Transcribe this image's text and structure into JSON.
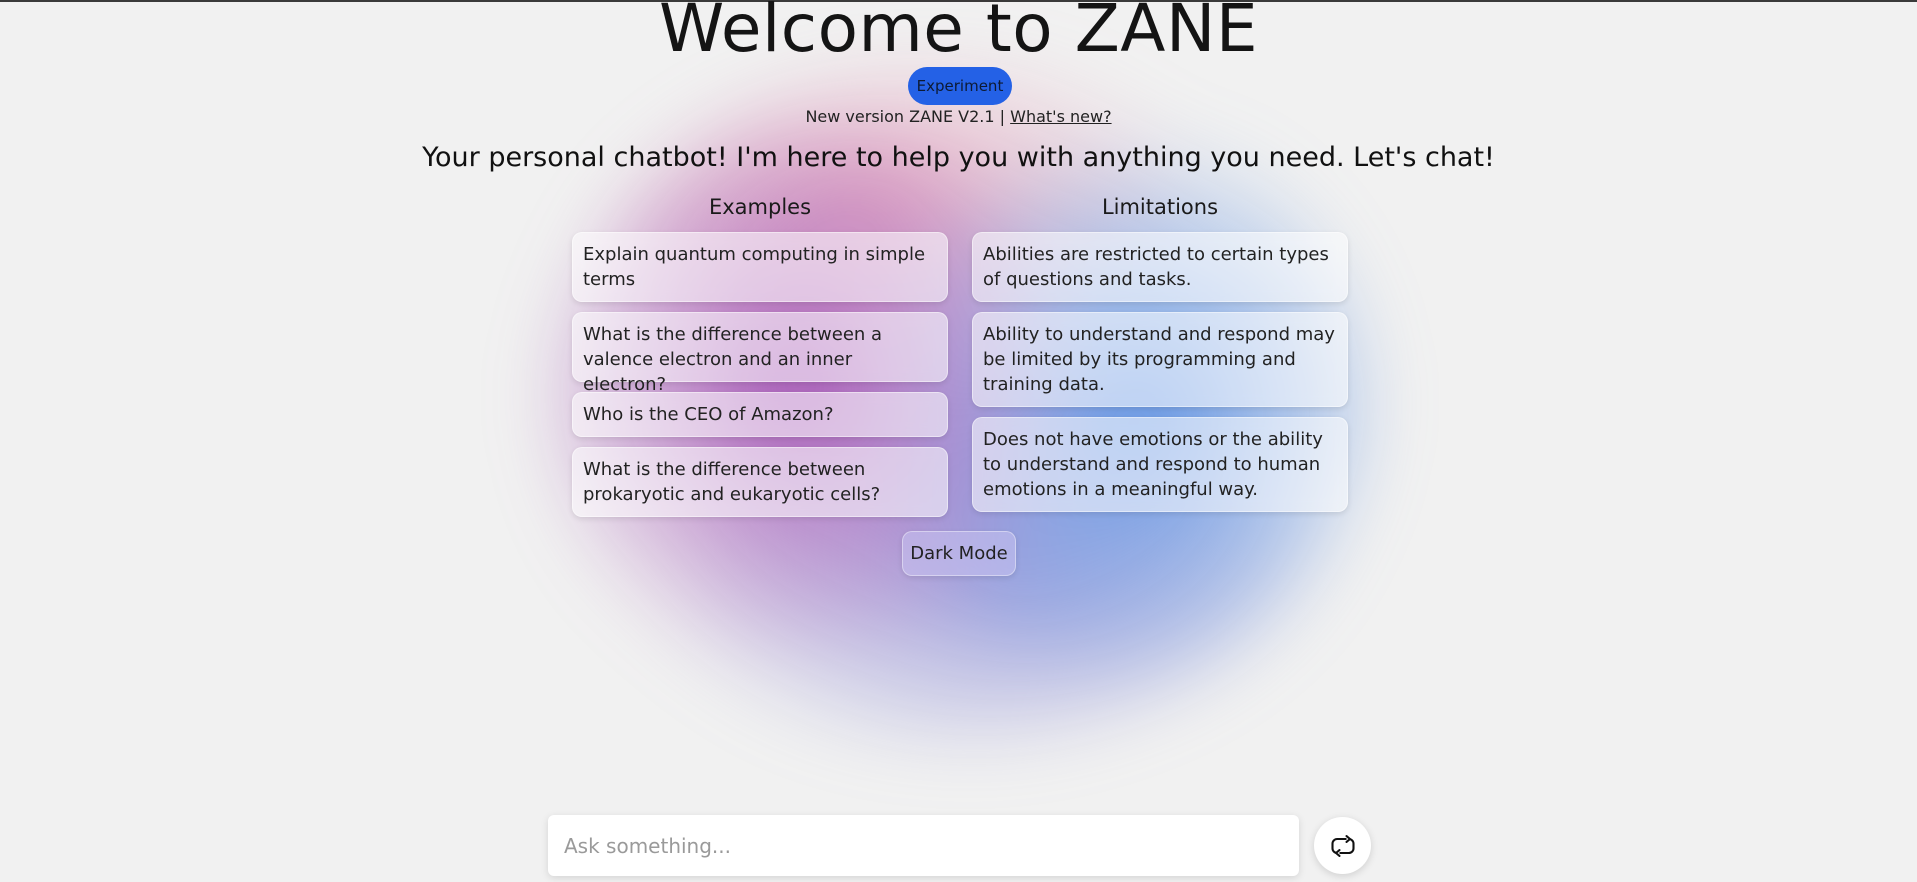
{
  "header": {
    "title": "Welcome to ZANE",
    "badge": "Experiment",
    "version_text": "New version ZANE V2.1 | ",
    "whats_new_link": "What's new?",
    "tagline": "Your personal chatbot! I'm here to help you with anything you need. Let's chat!"
  },
  "examples": {
    "heading": "Examples",
    "items": [
      "Explain quantum computing in simple terms",
      "What is the difference between a valence electron and an inner electron?",
      "Who is the CEO of Amazon?",
      "What is the difference between prokaryotic and eukaryotic cells?"
    ]
  },
  "limitations": {
    "heading": "Limitations",
    "items": [
      "Abilities are restricted to certain types of questions and tasks.",
      "Ability to understand and respond may be limited by its programming and training data.",
      "Does not have emotions or the ability to understand and respond to human emotions in a meaningful way."
    ]
  },
  "controls": {
    "dark_mode_label": "Dark Mode"
  },
  "chat_input": {
    "placeholder": "Ask something...",
    "value": ""
  },
  "icons": {
    "refresh": "refresh-icon"
  },
  "colors": {
    "accent": "#2461e6",
    "background": "#f1f1f1"
  }
}
